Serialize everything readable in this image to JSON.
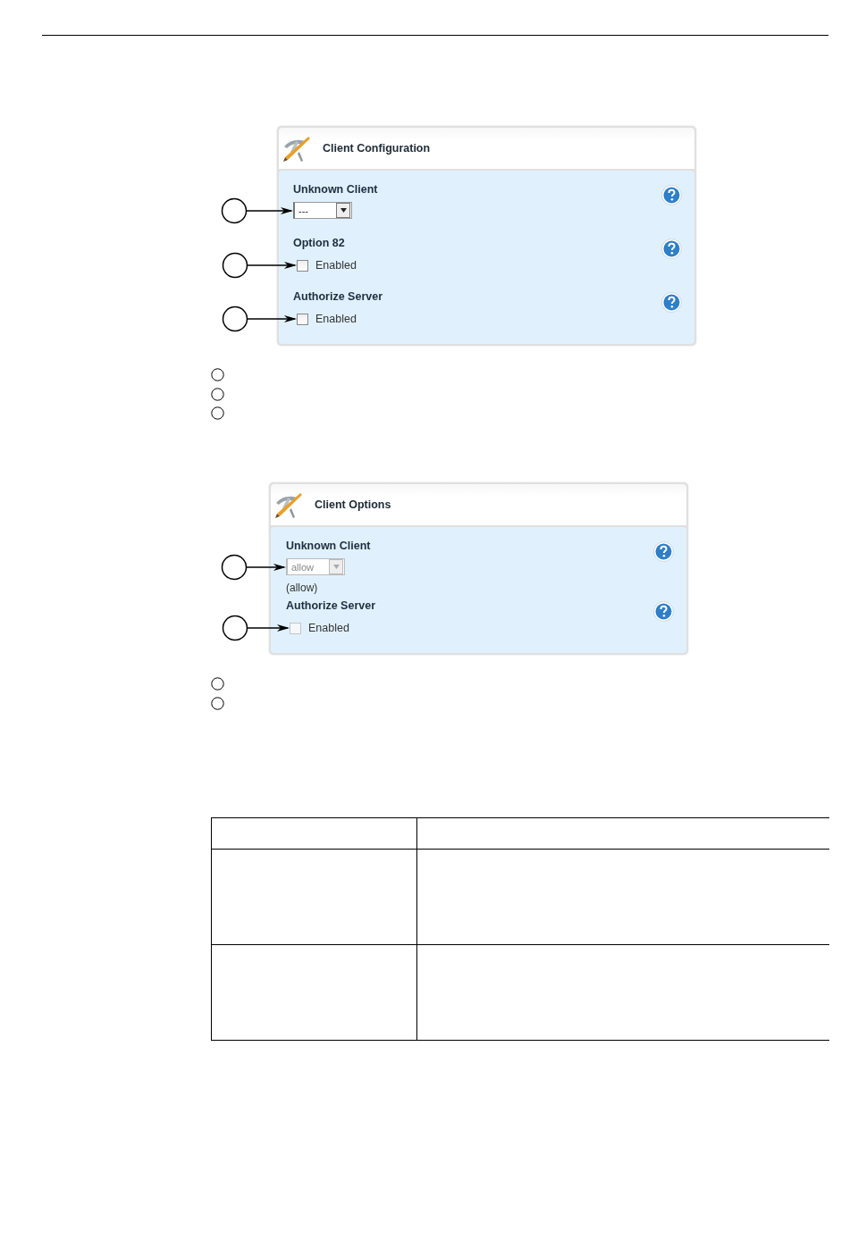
{
  "figures": [
    {
      "panel": {
        "title": "Client Configuration",
        "fields": [
          {
            "kind": "select",
            "label": "Unknown Client",
            "value": "---",
            "disabled": false
          },
          {
            "kind": "checkbox",
            "label": "Option 82",
            "option": "Enabled",
            "checked": false,
            "disabled": false
          },
          {
            "kind": "checkbox",
            "label": "Authorize Server",
            "option": "Enabled",
            "checked": false,
            "disabled": false
          }
        ]
      }
    },
    {
      "panel": {
        "title": "Client Options",
        "fields": [
          {
            "kind": "select",
            "label": "Unknown Client",
            "value": "allow",
            "disabled": true,
            "note": "(allow)"
          },
          {
            "kind": "checkbox",
            "label": "Authorize Server",
            "option": "Enabled",
            "checked": false,
            "disabled": true
          }
        ]
      }
    }
  ]
}
